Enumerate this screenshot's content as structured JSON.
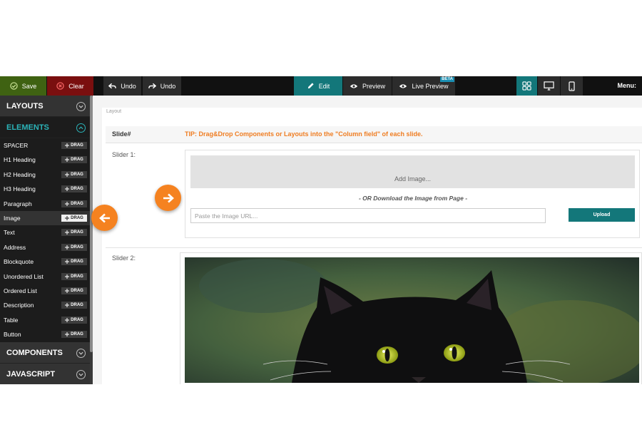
{
  "toolbar": {
    "save_label": "Save",
    "clear_label": "Clear",
    "undo_label": "Undo",
    "redo_label": "Undo",
    "edit_label": "Edit",
    "preview_label": "Preview",
    "live_preview_label": "Live Preview",
    "beta_badge": "BETA",
    "menu_label": "Menu:"
  },
  "sidebar": {
    "layouts_label": "LAYOUTS",
    "elements_label": "ELEMENTS",
    "components_label": "COMPONENTS",
    "javascript_label": "JAVASCRIPT",
    "drag_label": "DRAG",
    "elements": [
      {
        "label": "SPACER"
      },
      {
        "label": "H1 Heading"
      },
      {
        "label": "H2 Heading"
      },
      {
        "label": "H3 Heading"
      },
      {
        "label": "Paragraph"
      },
      {
        "label": "Image"
      },
      {
        "label": "Text"
      },
      {
        "label": "Address"
      },
      {
        "label": "Blockquote"
      },
      {
        "label": "Unordered List"
      },
      {
        "label": "Ordered List"
      },
      {
        "label": "Description"
      },
      {
        "label": "Table"
      },
      {
        "label": "Button"
      }
    ],
    "selected_element": "Image"
  },
  "canvas": {
    "layout_label": "Layout",
    "slide_header": "Slide#",
    "tip": "TIP: Drag&Drop Components or Layouts into the \"Column field\" of each slide.",
    "slider1_label": "Slider 1:",
    "slider2_label": "Slider 2:",
    "add_image_label": "Add Image...",
    "or_download_label": "- OR Download the Image from Page -",
    "url_placeholder": "Paste the Image URL...",
    "upload_label": "Upload"
  },
  "colors": {
    "accent_teal": "#13777a",
    "save_green": "#3f6212",
    "clear_red": "#7a0f0f",
    "tip_orange": "#ef7d22",
    "arrow_orange": "#f58220",
    "sidebar_dark": "#1c1c1c"
  },
  "icons": {
    "save": "save-check-icon",
    "clear": "clear-x-icon",
    "undo": "undo-arrow-icon",
    "redo": "redo-arrow-icon",
    "edit": "pencil-icon",
    "preview": "eye-icon",
    "live_preview": "eye-icon",
    "grid_view": "grid-icon",
    "desktop_view": "desktop-icon",
    "mobile_view": "mobile-icon"
  }
}
